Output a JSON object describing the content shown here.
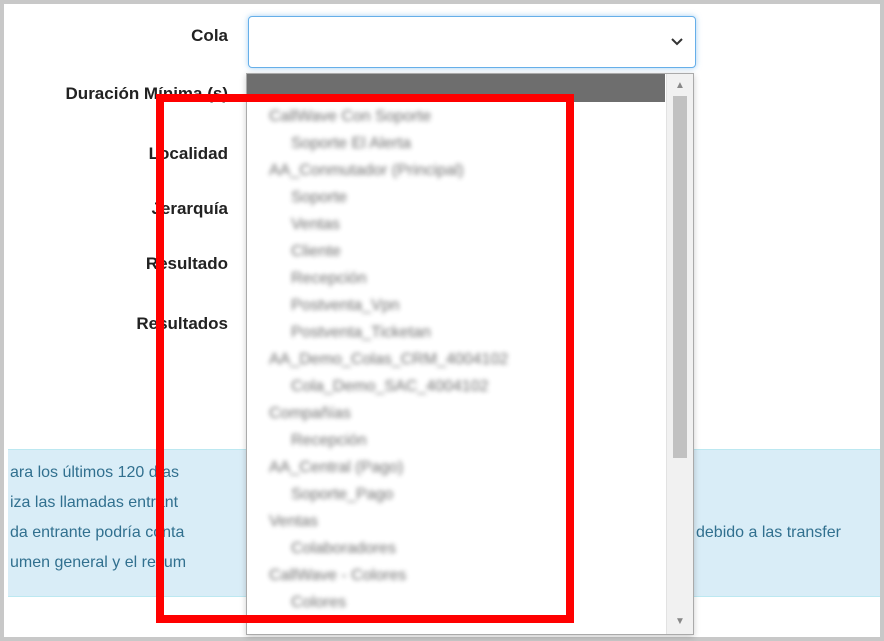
{
  "form": {
    "labels": {
      "cola": "Cola",
      "duracion": "Duración Mínima (s)",
      "localidad": "Localidad",
      "jerarquia": "Jerarquía",
      "resultado": "Resultado",
      "resultados": "Resultados"
    },
    "cola_select": {
      "value": "",
      "icon": "chevron-down-icon"
    }
  },
  "info": {
    "lines": [
      "ara los últimos 120 días",
      "iza las llamadas entrant",
      "da entrante podría conta",
      "umen general y el resum"
    ],
    "line3_suffix": "debido a las transfer"
  },
  "dropdown": {
    "selected_index": 0,
    "options": [
      {
        "label": "CallWave Con Soporte",
        "level": "group"
      },
      {
        "label": "Soporte El Alerta",
        "level": "child"
      },
      {
        "label": "AA_Conmutador (Principal)",
        "level": "group"
      },
      {
        "label": "Soporte",
        "level": "child"
      },
      {
        "label": "Ventas",
        "level": "child"
      },
      {
        "label": "Cliente",
        "level": "child"
      },
      {
        "label": "Recepción",
        "level": "child"
      },
      {
        "label": "Postventa_Vpn",
        "level": "child"
      },
      {
        "label": "Postventa_Ticketan",
        "level": "child"
      },
      {
        "label": "AA_Demo_Colas_CRM_4004102",
        "level": "group"
      },
      {
        "label": "Cola_Demo_SAC_4004102",
        "level": "child"
      },
      {
        "label": "Compañías",
        "level": "group"
      },
      {
        "label": "Recepción",
        "level": "child"
      },
      {
        "label": "AA_Central (Pago)",
        "level": "group"
      },
      {
        "label": "Soporte_Pago",
        "level": "child"
      },
      {
        "label": "Ventas",
        "level": "group"
      },
      {
        "label": "Colaboradores",
        "level": "child"
      },
      {
        "label": "CallWave - Colores",
        "level": "group"
      },
      {
        "label": "Colores",
        "level": "child"
      }
    ]
  },
  "annotation": {
    "color": "#ff0000"
  }
}
